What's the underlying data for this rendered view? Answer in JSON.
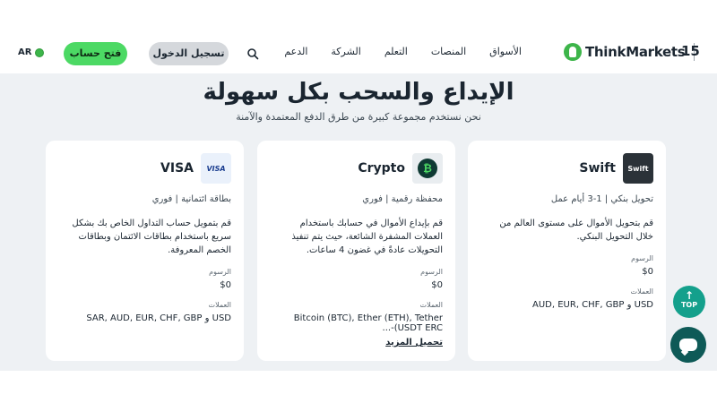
{
  "colors": {
    "accent_green": "#4cd964",
    "teal": "#14a08c",
    "dark_teal": "#0e5a57",
    "background_main": "#eef1f4"
  },
  "header": {
    "language": "AR",
    "open_account": "فتح حساب",
    "login": "تسجيل الدخول",
    "nav_links": [
      "الأسواق",
      "المنصات",
      "التعلم",
      "الشركة",
      "الدعم"
    ],
    "logo_text": "ThinkMarkets",
    "badge": "15"
  },
  "hero": {
    "title": "الإيداع والسحب بكل سهولة",
    "subtitle": "نحن نستخدم مجموعة كبيرة من طرق الدفع المعتمدة والآمنة"
  },
  "cards": [
    {
      "name": "Swift",
      "logo_text": "Swift",
      "subtitle": "تحويل بنكي | 1-3 أيام عمل",
      "description": "قم بتحويل الأموال على مستوى العالم من خلال التحويل البنكي.",
      "fees_label": "الرسوم",
      "fees_value": "$0",
      "currencies_label": "العملات",
      "currencies_value": "USD و AUD, EUR, CHF, GBP"
    },
    {
      "name": "Crypto",
      "logo_text": "₿",
      "subtitle": "محفظة رقمية | فوري",
      "description": "قم بإيداع الأموال في حسابك باستخدام العملات المشفرة الشائعة، حيث يتم تنفيذ التحويلات عادةً في غضون 4 ساعات.",
      "fees_label": "الرسوم",
      "fees_value": "$0",
      "currencies_label": "العملات",
      "currencies_value": "Bitcoin (BTC), Ether (ETH), Tether (USDT ERC-...",
      "more_link": "تحميل المزيد"
    },
    {
      "name": "VISA",
      "logo_text": "VISA",
      "subtitle": "بطاقة ائتمانية | فوري",
      "description": "قم بتمويل حساب التداول الخاص بك بشكل سريع باستخدام بطاقات الائتمان وبطاقات الخصم المعروفة.",
      "fees_label": "الرسوم",
      "fees_value": "$0",
      "currencies_label": "العملات",
      "currencies_value": "USD و SAR, AUD, EUR, CHF, GBP"
    }
  ],
  "floating": {
    "top_label": "TOP"
  }
}
